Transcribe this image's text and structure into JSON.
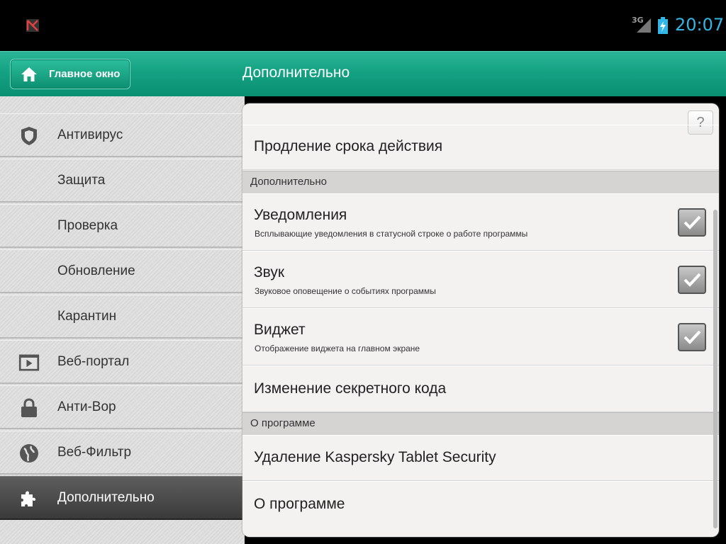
{
  "status_bar": {
    "network": "3G",
    "clock": "20:07",
    "clock_color": "#33b5e5"
  },
  "header": {
    "home_label": "Главное окно",
    "title": "Дополнительно",
    "accent": "#14a283"
  },
  "sidebar": {
    "items": [
      {
        "label": "Антивирус",
        "icon": "shield-icon"
      },
      {
        "label": "Защита",
        "icon": ""
      },
      {
        "label": "Проверка",
        "icon": ""
      },
      {
        "label": "Обновление",
        "icon": ""
      },
      {
        "label": "Карантин",
        "icon": ""
      },
      {
        "label": "Веб-портал",
        "icon": "web-portal-icon"
      },
      {
        "label": "Анти-Вор",
        "icon": "lock-icon"
      },
      {
        "label": "Веб-Фильтр",
        "icon": "globe-icon"
      },
      {
        "label": "Дополнительно",
        "icon": "puzzle-icon",
        "active": true
      }
    ]
  },
  "panel": {
    "help_label": "?",
    "extend_license": "Продление срока действия",
    "section_additional": "Дополнительно",
    "notifications": {
      "title": "Уведомления",
      "subtitle": "Всплывающие уведомления в статусной строке о работе программы",
      "checked": true
    },
    "sound": {
      "title": "Звук",
      "subtitle": "Звуковое оповещение о событиях программы",
      "checked": true
    },
    "widget": {
      "title": "Виджет",
      "subtitle": "Отображение виджета на главном экране",
      "checked": true
    },
    "change_code": "Изменение секретного кода",
    "section_about": "О программе",
    "uninstall": "Удаление Kaspersky Tablet Security",
    "about": "О программе"
  }
}
